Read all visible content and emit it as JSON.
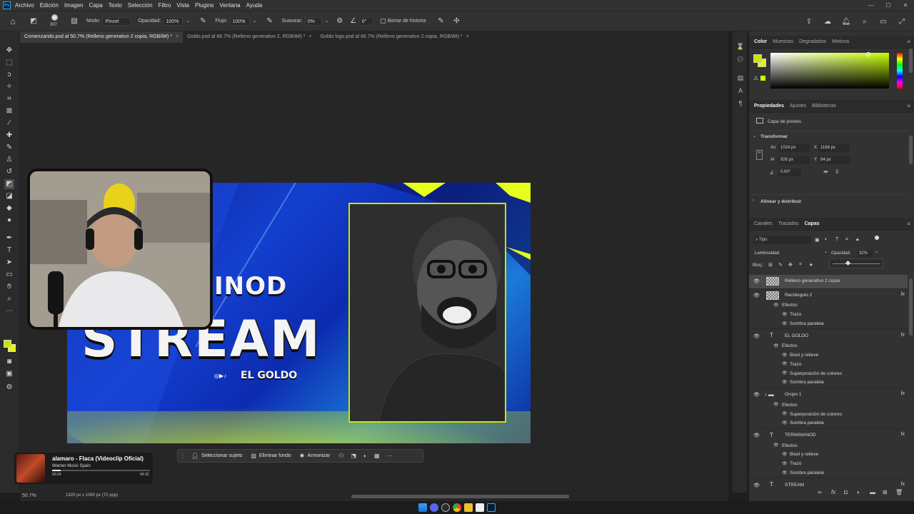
{
  "menu": {
    "items": [
      "Archivo",
      "Edición",
      "Imagen",
      "Capa",
      "Texto",
      "Selección",
      "Filtro",
      "Vista",
      "Plugins",
      "Ventana",
      "Ayuda"
    ]
  },
  "options_bar": {
    "brush_size": "307",
    "mode_label": "Modo:",
    "mode_value": "Pincel",
    "opacity_label": "Opacidad:",
    "opacity_value": "100%",
    "flow_label": "Flujo:",
    "flow_value": "100%",
    "smoothing_label": "Suavizar:",
    "smoothing_value": "0%",
    "angle_value": "0°",
    "history_label": "Borrar de historia"
  },
  "tabs": [
    {
      "label": "Comenzando.psd al 50.7% (Relleno generativo 2 copia, RGB/8#) *",
      "close": "×"
    },
    {
      "label": "Goldo.psd al 66.7% (Relleno generativo 2, RGB/8#) *",
      "close": "×"
    },
    {
      "label": "Goldo logo.psd al 66.7% (Relleno generativo 2 copia, RGB/8#) *",
      "close": "×"
    }
  ],
  "artboard": {
    "headline_top": "INOD",
    "headline_main": "STREAM",
    "social_handle": "EL GOLDO"
  },
  "context_bar": {
    "select_subject": "Seleccionar sujeto",
    "remove_bg": "Eliminar fondo",
    "harmonize": "Armonizar"
  },
  "media_popup": {
    "title": "alamaro - Flaca (Videoclip Oficial)",
    "artist": "Warner Music Spain",
    "elapsed": "00:24",
    "duration": "04:32",
    "progress": 0.09
  },
  "status": {
    "zoom": "50.7%",
    "doc_info": "1920 px x 1080 px (72 ppp)"
  },
  "color_panel": {
    "tabs": [
      "Color",
      "Muestras",
      "Degradados",
      "Motivos"
    ],
    "foreground": "#c8e600",
    "background": "#e6f01e"
  },
  "properties_panel": {
    "tabs": [
      "Propiedades",
      "Ajustes",
      "Bibliotecas"
    ],
    "layer_kind": "Capa de píxeles",
    "transform_title": "Transformar",
    "w_label": "An",
    "w_value": "1024 px",
    "h_label": "Al",
    "h_value": "926 px",
    "x_label": "X",
    "x_value": "1168 px",
    "y_label": "Y",
    "y_value": "84 px",
    "angle_value": "0.00°",
    "align_title": "Alinear y distribuir"
  },
  "layers_panel": {
    "tabs": [
      "Canales",
      "Trazados",
      "Capas"
    ],
    "filter_label": "Tipo",
    "blend_mode": "Luminosidad",
    "opacity_label": "Opacidad:",
    "opacity_value": "32%",
    "opacity_fraction": 0.32,
    "lock_label": "Bloq.:",
    "rows": [
      {
        "name": "Relleno generativo 2 copia",
        "kind": "pixel",
        "indent": 0,
        "fx": "",
        "eye": "visible",
        "selected": true
      },
      {
        "name": "Rectángulo 2",
        "kind": "shape",
        "indent": 0,
        "fx": "fx",
        "eye": "visible",
        "selected": false
      },
      {
        "name": "Efectos",
        "kind": "effects",
        "indent": 1,
        "fx": "",
        "eye": "",
        "selected": false
      },
      {
        "name": "Trazo",
        "kind": "effect",
        "indent": 2,
        "fx": "",
        "eye": "",
        "selected": false
      },
      {
        "name": "Sombra paralela",
        "kind": "effect",
        "indent": 2,
        "fx": "",
        "eye": "",
        "selected": false
      },
      {
        "name": "EL GOLDO",
        "kind": "text",
        "indent": 0,
        "fx": "fx",
        "eye": "visible",
        "selected": false
      },
      {
        "name": "Efectos",
        "kind": "effects",
        "indent": 1,
        "fx": "",
        "eye": "",
        "selected": false
      },
      {
        "name": "Bisel y relieve",
        "kind": "effect",
        "indent": 2,
        "fx": "",
        "eye": "",
        "selected": false
      },
      {
        "name": "Trazo",
        "kind": "effect",
        "indent": 2,
        "fx": "",
        "eye": "",
        "selected": false
      },
      {
        "name": "Superposición de colores",
        "kind": "effect",
        "indent": 2,
        "fx": "",
        "eye": "",
        "selected": false
      },
      {
        "name": "Sombra paralela",
        "kind": "effect",
        "indent": 2,
        "fx": "",
        "eye": "",
        "selected": false
      },
      {
        "name": "Grupo 1",
        "kind": "group",
        "indent": 0,
        "fx": "fx",
        "eye": "visible",
        "selected": false
      },
      {
        "name": "Efectos",
        "kind": "effects",
        "indent": 1,
        "fx": "",
        "eye": "",
        "selected": false
      },
      {
        "name": "Superposición de colores",
        "kind": "effect",
        "indent": 2,
        "fx": "",
        "eye": "",
        "selected": false
      },
      {
        "name": "Sombra paralela",
        "kind": "effect",
        "indent": 2,
        "fx": "",
        "eye": "",
        "selected": false
      },
      {
        "name": "TERMINANOD",
        "kind": "text",
        "indent": 0,
        "fx": "fx",
        "eye": "visible",
        "selected": false
      },
      {
        "name": "Efectos",
        "kind": "effects",
        "indent": 1,
        "fx": "",
        "eye": "",
        "selected": false
      },
      {
        "name": "Bisel y relieve",
        "kind": "effect",
        "indent": 2,
        "fx": "",
        "eye": "",
        "selected": false
      },
      {
        "name": "Trazo",
        "kind": "effect",
        "indent": 2,
        "fx": "",
        "eye": "",
        "selected": false
      },
      {
        "name": "Sombra paralela",
        "kind": "effect",
        "indent": 2,
        "fx": "",
        "eye": "",
        "selected": false
      },
      {
        "name": "STREAM",
        "kind": "text",
        "indent": 0,
        "fx": "fx",
        "eye": "visible",
        "selected": false
      }
    ]
  },
  "accent": "#c8e600"
}
